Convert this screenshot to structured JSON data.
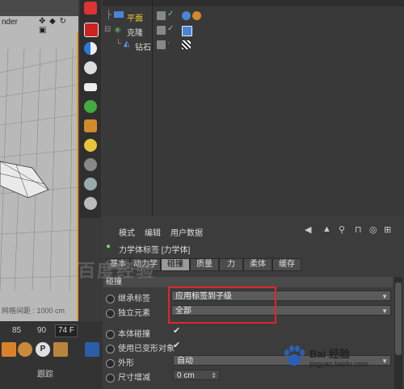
{
  "viewport": {
    "title": "nder",
    "tools": "✥ ◆ ↻ ▣",
    "grid_info": "网格间距 : 1000 cm"
  },
  "timeline": {
    "ticks": [
      "85",
      "90"
    ],
    "frame_value": "74 F",
    "label": "跟踪"
  },
  "object_manager": {
    "objects": [
      {
        "name": "平面"
      },
      {
        "name": "克隆"
      },
      {
        "name": "钻石"
      }
    ]
  },
  "attribute_manager": {
    "menu": [
      "模式",
      "编辑",
      "用户数据"
    ],
    "title": "力学体标签 [力学体]",
    "tabs": [
      "基本",
      "动力学",
      "碰撞",
      "质量",
      "力",
      "柔体",
      "缓存"
    ],
    "active_tab": "碰撞",
    "section": "碰撞",
    "properties": [
      {
        "label": "继承标签",
        "value": "应用标签到子级"
      },
      {
        "label": "独立元素",
        "value": "全部"
      },
      {
        "label": "本体碰撞",
        "value": "✔"
      },
      {
        "label": "使用已变形对象",
        "value": "✔"
      },
      {
        "label": "外形",
        "value": "自动"
      },
      {
        "label": "尺寸增减",
        "value": "0 cm"
      }
    ]
  },
  "watermark": {
    "left_text": "百度经验",
    "logo_text": "Bai 经验",
    "url": "jingyan.baidu.com"
  },
  "colors": {
    "highlight_red": "#e0262a",
    "orange_accent": "#e59a2e",
    "check_green": "#6fd36f"
  }
}
